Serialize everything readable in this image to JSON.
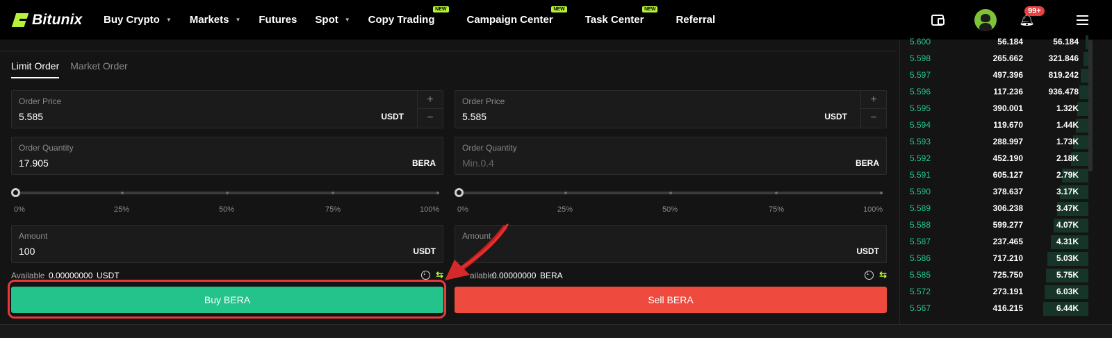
{
  "nav": {
    "logo": "Bitunix",
    "items": [
      {
        "label": "Buy Crypto",
        "caret": true,
        "badge": ""
      },
      {
        "label": "Markets",
        "caret": true,
        "badge": ""
      },
      {
        "label": "Futures",
        "caret": false,
        "badge": ""
      },
      {
        "label": "Spot",
        "caret": true,
        "badge": ""
      },
      {
        "label": "Copy Trading",
        "caret": false,
        "badge": "NEW"
      },
      {
        "label": "Campaign Center",
        "caret": false,
        "badge": "NEW"
      },
      {
        "label": "Task Center",
        "caret": false,
        "badge": "NEW"
      },
      {
        "label": "Referral",
        "caret": false,
        "badge": ""
      }
    ],
    "notification_count": "99+"
  },
  "tabs": {
    "limit": "Limit Order",
    "market": "Market Order"
  },
  "buy": {
    "price_label": "Order Price",
    "price_value": "5.585",
    "price_unit": "USDT",
    "qty_label": "Order Quantity",
    "qty_value": "17.905",
    "qty_unit": "BERA",
    "slider_percent": 0,
    "amount_label": "Amount",
    "amount_value": "100",
    "amount_unit": "USDT",
    "available_label": "Available",
    "available_value": "0.00000000",
    "available_unit": "USDT",
    "button": "Buy BERA"
  },
  "sell": {
    "price_label": "Order Price",
    "price_value": "5.585",
    "price_unit": "USDT",
    "qty_label": "Order Quantity",
    "qty_placeholder": "Min.0.4",
    "qty_unit": "BERA",
    "slider_percent": 0,
    "amount_label": "Amount",
    "amount_unit": "USDT",
    "available_label": "ailable",
    "available_value": "0.00000000",
    "available_unit": "BERA",
    "button": "Sell BERA"
  },
  "slider_marks": [
    "0%",
    "25%",
    "50%",
    "75%",
    "100%"
  ],
  "stepper": {
    "plus": "+",
    "minus": "−"
  },
  "colors": {
    "buy": "#23c38b",
    "sell": "#ee4b3e",
    "brand": "#b7f23a",
    "highlight": "#e63b3b"
  },
  "order_book": [
    {
      "price": "5.600",
      "qty": "56.184",
      "total": "56.184",
      "depth": 0.02
    },
    {
      "price": "5.598",
      "qty": "265.662",
      "total": "321.846",
      "depth": 0.04
    },
    {
      "price": "5.597",
      "qty": "497.396",
      "total": "819.242",
      "depth": 0.06
    },
    {
      "price": "5.596",
      "qty": "117.236",
      "total": "936.478",
      "depth": 0.07
    },
    {
      "price": "5.595",
      "qty": "390.001",
      "total": "1.32K",
      "depth": 0.09
    },
    {
      "price": "5.594",
      "qty": "119.670",
      "total": "1.44K",
      "depth": 0.1
    },
    {
      "price": "5.593",
      "qty": "288.997",
      "total": "1.73K",
      "depth": 0.12
    },
    {
      "price": "5.592",
      "qty": "452.190",
      "total": "2.18K",
      "depth": 0.14
    },
    {
      "price": "5.591",
      "qty": "605.127",
      "total": "2.79K",
      "depth": 0.21
    },
    {
      "price": "5.590",
      "qty": "378.637",
      "total": "3.17K",
      "depth": 0.23
    },
    {
      "price": "5.589",
      "qty": "306.238",
      "total": "3.47K",
      "depth": 0.25
    },
    {
      "price": "5.588",
      "qty": "599.277",
      "total": "4.07K",
      "depth": 0.28
    },
    {
      "price": "5.587",
      "qty": "237.465",
      "total": "4.31K",
      "depth": 0.3
    },
    {
      "price": "5.586",
      "qty": "717.210",
      "total": "5.03K",
      "depth": 0.33
    },
    {
      "price": "5.585",
      "qty": "725.750",
      "total": "5.75K",
      "depth": 0.34
    },
    {
      "price": "5.572",
      "qty": "273.191",
      "total": "6.03K",
      "depth": 0.35
    },
    {
      "price": "5.567",
      "qty": "416.215",
      "total": "6.44K",
      "depth": 0.36
    }
  ]
}
